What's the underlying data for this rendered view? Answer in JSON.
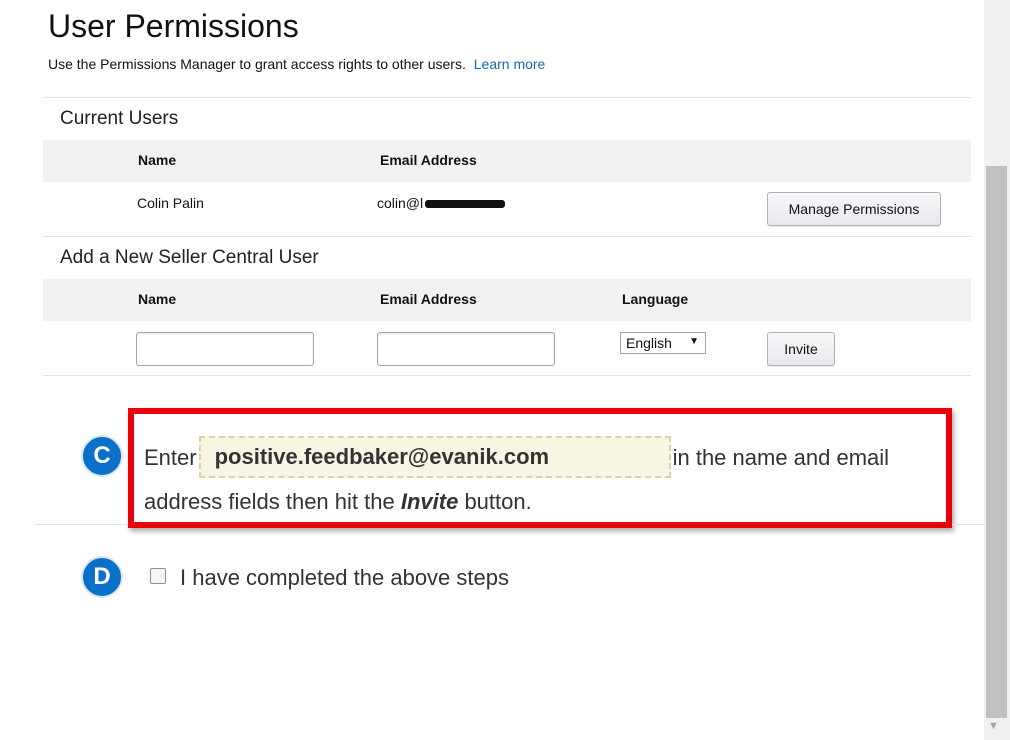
{
  "page": {
    "title": "User Permissions",
    "subtitle": "Use the Permissions Manager to grant access rights to other users.",
    "learn_more": "Learn more"
  },
  "current_users": {
    "section_title": "Current Users",
    "columns": [
      "Name",
      "Email Address"
    ],
    "rows": [
      {
        "name": "Colin Palin",
        "email_visible": "colin@l",
        "action_label": "Manage Permissions"
      }
    ]
  },
  "add_user": {
    "section_title": "Add a New Seller Central User",
    "columns": [
      "Name",
      "Email Address",
      "Language"
    ],
    "name_value": "",
    "email_value": "",
    "language_selected": "English",
    "invite_label": "Invite"
  },
  "steps": {
    "c": {
      "badge": "C",
      "text_before": "Enter",
      "highlight_email": "positive.feedbaker@evanik.com",
      "text_after": "in the name and email address fields then hit the",
      "emphasis": "Invite",
      "text_end": "button."
    },
    "d": {
      "badge": "D",
      "checkbox_label": "I have completed the above steps",
      "checked": false
    }
  },
  "colors": {
    "link": "#1a6ab2",
    "step_badge": "#0b70c9",
    "callout_border": "#e8000b",
    "highlight_bg": "#f8f5e2"
  }
}
